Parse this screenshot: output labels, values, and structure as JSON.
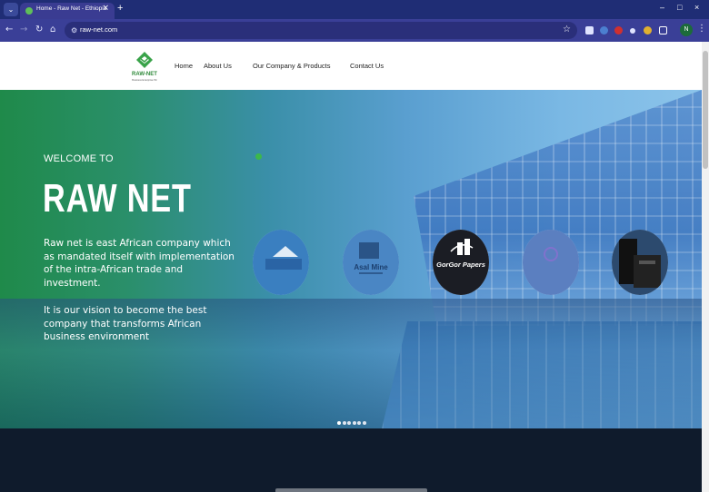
{
  "browser": {
    "tab_title": "Home - Raw Net - Ethiopia",
    "tab_close": "×",
    "new_tab": "+",
    "url": "raw-net.com",
    "profile_initial": "N",
    "window_controls": [
      "–",
      "□",
      "×"
    ]
  },
  "site": {
    "logo_text": "RAW-NET",
    "logo_subtext": "Business Enterprise Plc",
    "nav": [
      "Home",
      "About Us",
      "Our Company & Products",
      "Contact Us"
    ]
  },
  "hero": {
    "welcome": "WELCOME TO",
    "title": "RAW NET",
    "paragraph1": "Raw net is east African company which as mandated itself with implementation of the intra-African trade and investment.",
    "paragraph2": "It is our vision to become the best company that transforms African business environment",
    "companies": [
      {
        "label": "",
        "bg": "#3a7fc0",
        "text_color": "#1a4a8a"
      },
      {
        "label": "Asal Mine",
        "bg": "#4a86c4",
        "text_color": "#1c3f6e"
      },
      {
        "label": "GorGor Papers",
        "bg": "#1b1d24",
        "text_color": "#ffffff"
      },
      {
        "label": "",
        "bg": "#5b7fc0",
        "text_color": "#8a6fd0"
      },
      {
        "label": "",
        "bg": "#2c4a6e",
        "text_color": "#ffffff"
      }
    ],
    "slider_count": 6,
    "slider_active": 0
  },
  "colors": {
    "tab_bar": "#1f2d75",
    "address_bar": "#3a3f97",
    "hero_green": "#1f8a4a",
    "hero_blue": "#7ab8e4",
    "dark_section": "#0f1b2c"
  }
}
